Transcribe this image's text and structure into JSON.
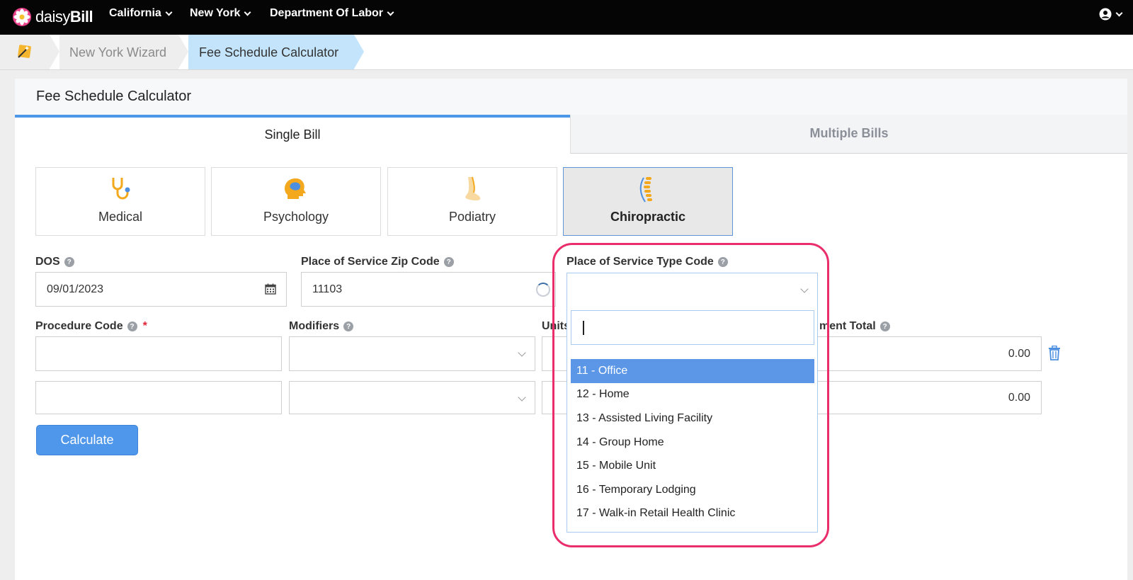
{
  "navbar": {
    "brand_light": "daisy",
    "brand_bold": "Bill",
    "items": [
      {
        "label": "California"
      },
      {
        "label": "New York"
      },
      {
        "label": "Department Of Labor"
      }
    ]
  },
  "breadcrumb": {
    "items": [
      {
        "label": "New York Wizard"
      },
      {
        "label": "Fee Schedule Calculator"
      }
    ]
  },
  "card": {
    "title": "Fee Schedule Calculator",
    "tabs": [
      {
        "label": "Single Bill",
        "active": true
      },
      {
        "label": "Multiple Bills",
        "active": false
      }
    ],
    "specialties": [
      {
        "label": "Medical",
        "icon": "stethoscope-icon"
      },
      {
        "label": "Psychology",
        "icon": "brain-head-icon"
      },
      {
        "label": "Podiatry",
        "icon": "foot-icon"
      },
      {
        "label": "Chiropractic",
        "icon": "spine-icon",
        "active": true
      }
    ]
  },
  "form": {
    "dos": {
      "label": "DOS",
      "value": "09/01/2023"
    },
    "zip": {
      "label": "Place of Service Zip Code",
      "value": "11103"
    },
    "pos_type": {
      "label": "Place of Service Type Code",
      "value": ""
    },
    "procedure": {
      "label": "Procedure Code",
      "required_mark": "*"
    },
    "modifiers": {
      "label": "Modifiers"
    },
    "units": {
      "label": "Units"
    },
    "payment_total": {
      "label": "ment Total"
    },
    "rows": [
      {
        "procedure": "",
        "modifiers": "",
        "units": "",
        "total": "0.00"
      },
      {
        "procedure": "",
        "modifiers": "",
        "units": "",
        "total": "0.00"
      }
    ],
    "calculate_label": "Calculate"
  },
  "dropdown": {
    "search_value": "",
    "options": [
      {
        "label": "11 - Office",
        "selected": true
      },
      {
        "label": "12 - Home"
      },
      {
        "label": "13 - Assisted Living Facility"
      },
      {
        "label": "14 - Group Home"
      },
      {
        "label": "15 - Mobile Unit"
      },
      {
        "label": "16 - Temporary Lodging"
      },
      {
        "label": "17 - Walk-in Retail Health Clinic"
      }
    ]
  },
  "colors": {
    "accent": "#4f97ea",
    "highlight": "#ea2e6c",
    "breadcrumb_active": "#c4e4fb"
  }
}
